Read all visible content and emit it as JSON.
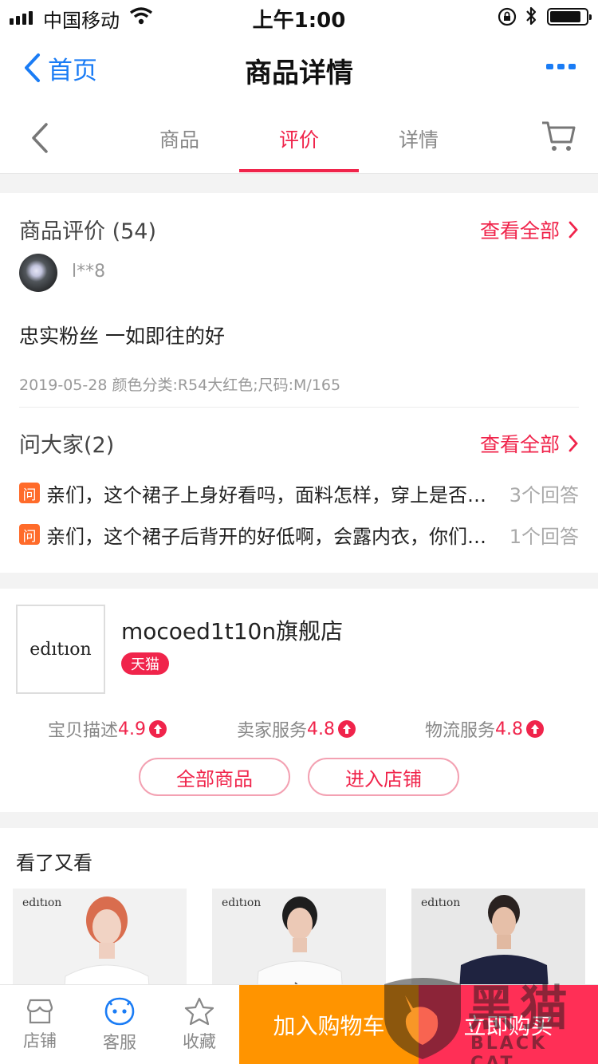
{
  "status_bar": {
    "carrier": "中国移动",
    "time": "上午1:00"
  },
  "nav": {
    "back_label": "首页",
    "title": "商品详情",
    "more_icon": "more-icon"
  },
  "tabs": [
    {
      "label": "商品",
      "active": false
    },
    {
      "label": "评价",
      "active": true
    },
    {
      "label": "详情",
      "active": false
    }
  ],
  "review_section": {
    "title": "商品评价 (54)",
    "see_all": "查看全部",
    "review": {
      "username": "l**8",
      "text": "忠实粉丝 一如即往的好",
      "meta": "2019-05-28 颜色分类:R54大红色;尺码:M/165"
    }
  },
  "qa_section": {
    "title": "问大家(2)",
    "see_all": "查看全部",
    "badge": "问",
    "items": [
      {
        "question": "亲们，这个裙子上身好看吗，面料怎样，穿上是否显胖",
        "answers": "3个回答"
      },
      {
        "question": "亲们，这个裙子后背开的好低啊，会露内衣，你们都怎么穿的",
        "answers": "1个回答"
      }
    ]
  },
  "shop": {
    "logo_text": "edıtıon",
    "name": "mocoed1t10n旗舰店",
    "badge": "天猫",
    "scores": [
      {
        "label": "宝贝描述",
        "value": "4.9"
      },
      {
        "label": "卖家服务",
        "value": "4.8"
      },
      {
        "label": "物流服务",
        "value": "4.8"
      }
    ],
    "buttons": {
      "all_products": "全部商品",
      "enter_shop": "进入店铺"
    }
  },
  "recommend": {
    "title": "看了又看",
    "items": [
      {
        "brand": "edıtıon"
      },
      {
        "brand": "edıtıon"
      },
      {
        "brand": "edıtıon"
      }
    ]
  },
  "bottom_bar": {
    "shop": "店铺",
    "service": "客服",
    "favorite": "收藏",
    "add_to_cart": "加入购物车",
    "buy_now": "立即购买"
  },
  "watermark": {
    "cn": "黑猫",
    "en": "BLACK CAT"
  },
  "colors": {
    "accent": "#f0244b",
    "link_blue": "#1a7cf5",
    "cart_orange": "#ff9400",
    "buy_red": "#ff2f56",
    "qa_badge": "#ff6b2a"
  }
}
